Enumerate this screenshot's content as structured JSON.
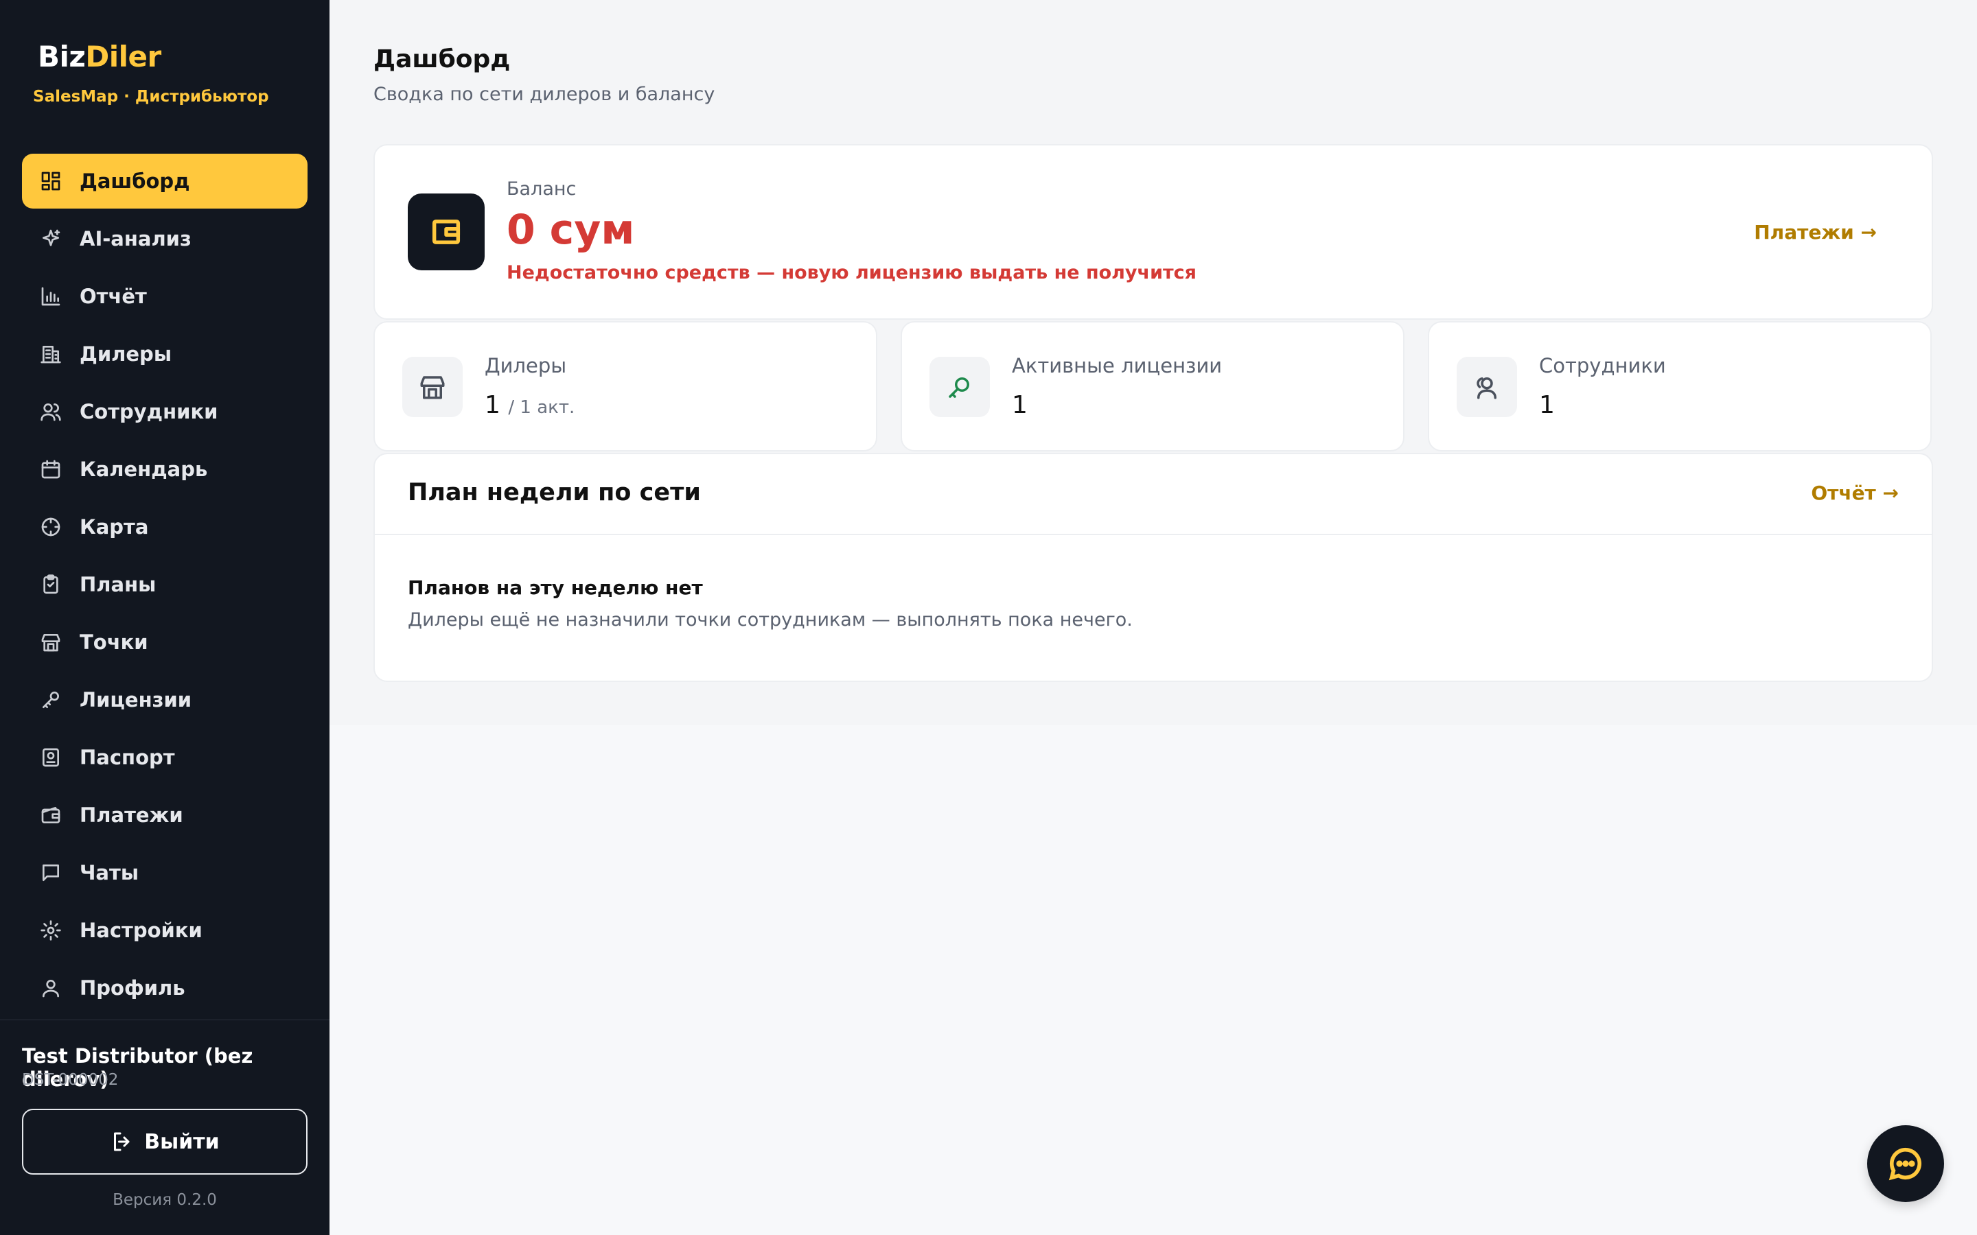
{
  "sidebar": {
    "brand_part1": "Biz",
    "brand_part2": "Diler",
    "brand_sub": "SalesMap · Дистрибьютор",
    "items": [
      {
        "label": "Дашборд",
        "icon": "dashboard-icon",
        "active": true
      },
      {
        "label": "AI-анализ",
        "icon": "sparkle-icon"
      },
      {
        "label": "Отчёт",
        "icon": "bar-chart-icon"
      },
      {
        "label": "Дилеры",
        "icon": "building-icon"
      },
      {
        "label": "Сотрудники",
        "icon": "users-icon"
      },
      {
        "label": "Календарь",
        "icon": "calendar-icon"
      },
      {
        "label": "Карта",
        "icon": "crosshair-icon"
      },
      {
        "label": "Планы",
        "icon": "clipboard-icon"
      },
      {
        "label": "Точки",
        "icon": "store-icon"
      },
      {
        "label": "Лицензии",
        "icon": "key-icon"
      },
      {
        "label": "Паспорт",
        "icon": "id-card-icon"
      },
      {
        "label": "Платежи",
        "icon": "wallet-icon"
      },
      {
        "label": "Чаты",
        "icon": "message-icon"
      },
      {
        "label": "Настройки",
        "icon": "gear-icon"
      },
      {
        "label": "Профиль",
        "icon": "user-icon"
      }
    ],
    "user_name": "Test Distributor (bez dilerov)",
    "user_id": "DST-000002",
    "logout_label": "Выйти",
    "version": "Версия 0.2.0"
  },
  "header": {
    "title": "Дашборд",
    "subtitle": "Сводка по сети дилеров и балансу"
  },
  "balance": {
    "label": "Баланс",
    "value": "0 сум",
    "warning": "Недостаточно средств — новую лицензию выдать не получится",
    "link": "Платежи →"
  },
  "stats": [
    {
      "label": "Дилеры",
      "value": "1",
      "extra": "/ 1 акт.",
      "icon": "store-icon"
    },
    {
      "label": "Активные лицензии",
      "value": "1",
      "extra": "",
      "icon": "key-icon"
    },
    {
      "label": "Сотрудники",
      "value": "1",
      "extra": "",
      "icon": "users-icon"
    }
  ],
  "plan": {
    "title": "План недели по сети",
    "link": "Отчёт →",
    "empty_title": "Планов на эту неделю нет",
    "empty_desc": "Дилеры ещё не назначили точки сотрудникам — выполнять пока нечего."
  },
  "colors": {
    "accent": "#ffc83d",
    "sidebar_bg": "#121720",
    "danger": "#d43a35",
    "link": "#b07c00"
  }
}
